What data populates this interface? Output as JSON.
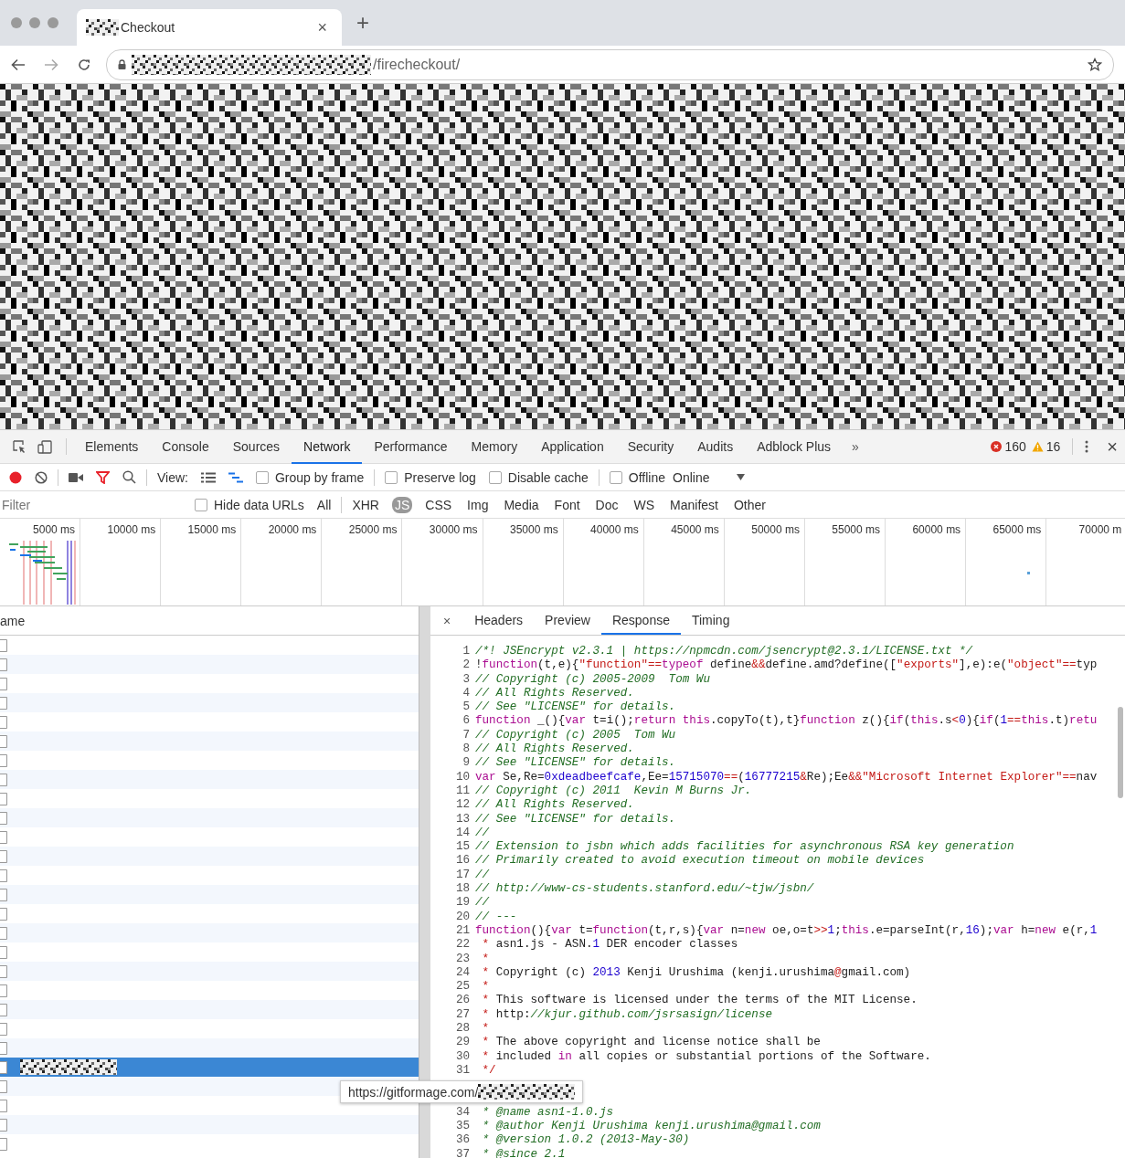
{
  "browser": {
    "tab": {
      "title": "Checkout",
      "close": "×"
    },
    "new_tab": "+",
    "address": {
      "path": "/firecheckout/"
    }
  },
  "devtools": {
    "panels": [
      {
        "label": "Elements",
        "selected": false
      },
      {
        "label": "Console",
        "selected": false
      },
      {
        "label": "Sources",
        "selected": false
      },
      {
        "label": "Network",
        "selected": true
      },
      {
        "label": "Performance",
        "selected": false
      },
      {
        "label": "Memory",
        "selected": false
      },
      {
        "label": "Application",
        "selected": false
      },
      {
        "label": "Security",
        "selected": false
      },
      {
        "label": "Audits",
        "selected": false
      },
      {
        "label": "Adblock Plus",
        "selected": false
      }
    ],
    "more": "»",
    "errors": "160",
    "warnings": "16",
    "close": "×",
    "toolbar": {
      "recording": true,
      "view_label": "View:",
      "throttle": "Online",
      "options": [
        {
          "label": "Group by frame",
          "checked": false
        },
        {
          "label": "Preserve log",
          "checked": false
        },
        {
          "label": "Disable cache",
          "checked": false
        },
        {
          "label": "Offline",
          "checked": false
        }
      ]
    },
    "filter": {
      "placeholder": "Filter",
      "hide_data_urls": {
        "label": "Hide data URLs",
        "checked": false
      },
      "types": [
        {
          "label": "All",
          "selected": false
        },
        {
          "label": "XHR",
          "selected": false
        },
        {
          "label": "JS",
          "selected": true
        },
        {
          "label": "CSS",
          "selected": false
        },
        {
          "label": "Img",
          "selected": false
        },
        {
          "label": "Media",
          "selected": false
        },
        {
          "label": "Font",
          "selected": false
        },
        {
          "label": "Doc",
          "selected": false
        },
        {
          "label": "WS",
          "selected": false
        },
        {
          "label": "Manifest",
          "selected": false
        },
        {
          "label": "Other",
          "selected": false
        }
      ]
    },
    "timeline": {
      "ticks": [
        "5000 ms",
        "10000 ms",
        "15000 ms",
        "20000 ms",
        "25000 ms",
        "30000 ms",
        "35000 ms",
        "40000 ms",
        "45000 ms",
        "50000 ms",
        "55000 ms",
        "60000 ms",
        "65000 ms",
        "70000 m"
      ]
    },
    "requests": {
      "header": "ame",
      "rows": [
        {
          "selected": false
        },
        {
          "selected": false
        },
        {
          "selected": false
        },
        {
          "selected": false
        },
        {
          "selected": false
        },
        {
          "selected": false
        },
        {
          "selected": false
        },
        {
          "selected": false
        },
        {
          "selected": false
        },
        {
          "selected": false
        },
        {
          "selected": false
        },
        {
          "selected": false
        },
        {
          "selected": false
        },
        {
          "selected": false
        },
        {
          "selected": false
        },
        {
          "selected": false
        },
        {
          "selected": false
        },
        {
          "selected": false
        },
        {
          "selected": false
        },
        {
          "selected": false
        },
        {
          "selected": false
        },
        {
          "selected": false
        },
        {
          "selected": true
        },
        {
          "selected": false
        },
        {
          "selected": false
        },
        {
          "selected": false
        },
        {
          "selected": false
        }
      ]
    },
    "detail": {
      "close": "×",
      "tabs": [
        {
          "label": "Headers",
          "selected": false
        },
        {
          "label": "Preview",
          "selected": false
        },
        {
          "label": "Response",
          "selected": true
        },
        {
          "label": "Timing",
          "selected": false
        }
      ],
      "lines": [
        {
          "kind": "code",
          "number": "1",
          "tokens": [
            {
              "kind": "c",
              "text": "/*! JSEncrypt v2.3.1 | https://npmcdn.com/jsencrypt@2.3.1/LICENSE.txt */"
            }
          ]
        },
        {
          "kind": "code",
          "number": "2",
          "tokens": [
            {
              "kind": "p",
              "text": "!"
            },
            {
              "kind": "k",
              "text": "function"
            },
            {
              "kind": "p",
              "text": "(t,e){"
            },
            {
              "kind": "s",
              "text": "\"function\""
            },
            {
              "kind": "o",
              "text": "=="
            },
            {
              "kind": "k",
              "text": "typeof"
            },
            {
              "kind": "p",
              "text": " define"
            },
            {
              "kind": "o",
              "text": "&&"
            },
            {
              "kind": "p",
              "text": "define.amd?define(["
            },
            {
              "kind": "s",
              "text": "\"exports\""
            },
            {
              "kind": "p",
              "text": "],e):e("
            },
            {
              "kind": "s",
              "text": "\"object\""
            },
            {
              "kind": "o",
              "text": "=="
            },
            {
              "kind": "p",
              "text": "typ"
            }
          ]
        },
        {
          "kind": "code",
          "number": "3",
          "tokens": [
            {
              "kind": "c",
              "text": "// Copyright (c) 2005-2009  Tom Wu"
            }
          ]
        },
        {
          "kind": "code",
          "number": "4",
          "tokens": [
            {
              "kind": "c",
              "text": "// All Rights Reserved."
            }
          ]
        },
        {
          "kind": "code",
          "number": "5",
          "tokens": [
            {
              "kind": "c",
              "text": "// See \"LICENSE\" for details."
            }
          ]
        },
        {
          "kind": "code",
          "number": "6",
          "tokens": [
            {
              "kind": "k",
              "text": "function"
            },
            {
              "kind": "p",
              "text": " _(){"
            },
            {
              "kind": "k",
              "text": "var"
            },
            {
              "kind": "p",
              "text": " t=i();"
            },
            {
              "kind": "k",
              "text": "return "
            },
            {
              "kind": "k",
              "text": "this"
            },
            {
              "kind": "p",
              "text": ".copyTo(t),t}"
            },
            {
              "kind": "k",
              "text": "function"
            },
            {
              "kind": "p",
              "text": " z(){"
            },
            {
              "kind": "k",
              "text": "if"
            },
            {
              "kind": "p",
              "text": "("
            },
            {
              "kind": "k",
              "text": "this"
            },
            {
              "kind": "p",
              "text": ".s"
            },
            {
              "kind": "o",
              "text": "<"
            },
            {
              "kind": "n",
              "text": "0"
            },
            {
              "kind": "p",
              "text": "){"
            },
            {
              "kind": "k",
              "text": "if"
            },
            {
              "kind": "p",
              "text": "("
            },
            {
              "kind": "n",
              "text": "1"
            },
            {
              "kind": "o",
              "text": "=="
            },
            {
              "kind": "k",
              "text": "this"
            },
            {
              "kind": "p",
              "text": ".t)"
            },
            {
              "kind": "k",
              "text": "retu"
            }
          ]
        },
        {
          "kind": "code",
          "number": "7",
          "tokens": [
            {
              "kind": "c",
              "text": "// Copyright (c) 2005  Tom Wu"
            }
          ]
        },
        {
          "kind": "code",
          "number": "8",
          "tokens": [
            {
              "kind": "c",
              "text": "// All Rights Reserved."
            }
          ]
        },
        {
          "kind": "code",
          "number": "9",
          "tokens": [
            {
              "kind": "c",
              "text": "// See \"LICENSE\" for details."
            }
          ]
        },
        {
          "kind": "code",
          "number": "10",
          "tokens": [
            {
              "kind": "k",
              "text": "var"
            },
            {
              "kind": "p",
              "text": " Se,Re="
            },
            {
              "kind": "n",
              "text": "0xdeadbeefcafe"
            },
            {
              "kind": "p",
              "text": ",Ee="
            },
            {
              "kind": "n",
              "text": "15715070"
            },
            {
              "kind": "o",
              "text": "=="
            },
            {
              "kind": "p",
              "text": "("
            },
            {
              "kind": "n",
              "text": "16777215"
            },
            {
              "kind": "o",
              "text": "&"
            },
            {
              "kind": "p",
              "text": "Re);Ee"
            },
            {
              "kind": "o",
              "text": "&&"
            },
            {
              "kind": "s",
              "text": "\"Microsoft Internet Explorer\""
            },
            {
              "kind": "o",
              "text": "=="
            },
            {
              "kind": "p",
              "text": "nav"
            }
          ]
        },
        {
          "kind": "code",
          "number": "11",
          "tokens": [
            {
              "kind": "c",
              "text": "// Copyright (c) 2011  Kevin M Burns Jr."
            }
          ]
        },
        {
          "kind": "code",
          "number": "12",
          "tokens": [
            {
              "kind": "c",
              "text": "// All Rights Reserved."
            }
          ]
        },
        {
          "kind": "code",
          "number": "13",
          "tokens": [
            {
              "kind": "c",
              "text": "// See \"LICENSE\" for details."
            }
          ]
        },
        {
          "kind": "code",
          "number": "14",
          "tokens": [
            {
              "kind": "c",
              "text": "//"
            }
          ]
        },
        {
          "kind": "code",
          "number": "15",
          "tokens": [
            {
              "kind": "c",
              "text": "// Extension to jsbn which adds facilities for asynchronous RSA key generation"
            }
          ]
        },
        {
          "kind": "code",
          "number": "16",
          "tokens": [
            {
              "kind": "c",
              "text": "// Primarily created to avoid execution timeout on mobile devices"
            }
          ]
        },
        {
          "kind": "code",
          "number": "17",
          "tokens": [
            {
              "kind": "c",
              "text": "//"
            }
          ]
        },
        {
          "kind": "code",
          "number": "18",
          "tokens": [
            {
              "kind": "c",
              "text": "// http://www-cs-students.stanford.edu/~tjw/jsbn/"
            }
          ]
        },
        {
          "kind": "code",
          "number": "19",
          "tokens": [
            {
              "kind": "c",
              "text": "//"
            }
          ]
        },
        {
          "kind": "code",
          "number": "20",
          "tokens": [
            {
              "kind": "c",
              "text": "// ---"
            }
          ]
        },
        {
          "kind": "code",
          "number": "21",
          "tokens": [
            {
              "kind": "k",
              "text": "function"
            },
            {
              "kind": "p",
              "text": "(){"
            },
            {
              "kind": "k",
              "text": "var"
            },
            {
              "kind": "p",
              "text": " t="
            },
            {
              "kind": "k",
              "text": "function"
            },
            {
              "kind": "p",
              "text": "(t,r,s){"
            },
            {
              "kind": "k",
              "text": "var"
            },
            {
              "kind": "p",
              "text": " n="
            },
            {
              "kind": "k",
              "text": "new"
            },
            {
              "kind": "p",
              "text": " oe,o=t"
            },
            {
              "kind": "o",
              "text": ">>"
            },
            {
              "kind": "n",
              "text": "1"
            },
            {
              "kind": "p",
              "text": ";"
            },
            {
              "kind": "k",
              "text": "this"
            },
            {
              "kind": "p",
              "text": ".e=parseInt(r,"
            },
            {
              "kind": "n",
              "text": "16"
            },
            {
              "kind": "p",
              "text": ");"
            },
            {
              "kind": "k",
              "text": "var"
            },
            {
              "kind": "p",
              "text": " h="
            },
            {
              "kind": "k",
              "text": "new"
            },
            {
              "kind": "p",
              "text": " e(r,"
            },
            {
              "kind": "n",
              "text": "1"
            }
          ]
        },
        {
          "kind": "code",
          "number": "22",
          "tokens": [
            {
              "kind": "o",
              "text": " * "
            },
            {
              "kind": "p",
              "text": "asn1.js - ASN."
            },
            {
              "kind": "n",
              "text": "1"
            },
            {
              "kind": "p",
              "text": " DER encoder classes"
            }
          ]
        },
        {
          "kind": "code",
          "number": "23",
          "tokens": [
            {
              "kind": "o",
              "text": " *"
            }
          ]
        },
        {
          "kind": "code",
          "number": "24",
          "tokens": [
            {
              "kind": "o",
              "text": " * "
            },
            {
              "kind": "p",
              "text": "Copyright (c) "
            },
            {
              "kind": "n",
              "text": "2013"
            },
            {
              "kind": "p",
              "text": " Kenji Urushima (kenji.urushima"
            },
            {
              "kind": "o",
              "text": "@"
            },
            {
              "kind": "p",
              "text": "gmail.com)"
            }
          ]
        },
        {
          "kind": "code",
          "number": "25",
          "tokens": [
            {
              "kind": "o",
              "text": " *"
            }
          ]
        },
        {
          "kind": "code",
          "number": "26",
          "tokens": [
            {
              "kind": "o",
              "text": " * "
            },
            {
              "kind": "p",
              "text": "This software is licensed under the terms of the MIT License."
            }
          ]
        },
        {
          "kind": "code",
          "number": "27",
          "tokens": [
            {
              "kind": "o",
              "text": " * "
            },
            {
              "kind": "p",
              "text": "http:"
            },
            {
              "kind": "c",
              "text": "//kjur.github.com/jsrsasign/license"
            }
          ]
        },
        {
          "kind": "code",
          "number": "28",
          "tokens": [
            {
              "kind": "o",
              "text": " *"
            }
          ]
        },
        {
          "kind": "code",
          "number": "29",
          "tokens": [
            {
              "kind": "o",
              "text": " * "
            },
            {
              "kind": "p",
              "text": "The above copyright and license notice shall be"
            }
          ]
        },
        {
          "kind": "code",
          "number": "30",
          "tokens": [
            {
              "kind": "o",
              "text": " * "
            },
            {
              "kind": "p",
              "text": "included "
            },
            {
              "kind": "k",
              "text": "in"
            },
            {
              "kind": "p",
              "text": " all copies or substantial portions of the Software."
            }
          ]
        },
        {
          "kind": "code",
          "number": "31",
          "tokens": [
            {
              "kind": "o",
              "text": " */"
            }
          ]
        },
        {
          "kind": "covered"
        },
        {
          "kind": "code",
          "number": "34",
          "tokens": [
            {
              "kind": "c",
              "text": " * @name asn1-1.0.js"
            }
          ]
        },
        {
          "kind": "code",
          "number": "35",
          "tokens": [
            {
              "kind": "c",
              "text": " * @author Kenji Urushima kenji.urushima@gmail.com"
            }
          ]
        },
        {
          "kind": "code",
          "number": "36",
          "tokens": [
            {
              "kind": "c",
              "text": " * @version 1.0.2 (2013-May-30)"
            }
          ]
        },
        {
          "kind": "code",
          "number": "37",
          "tokens": [
            {
              "kind": "c",
              "text": " * @since 2.1"
            }
          ]
        }
      ]
    },
    "tooltip": {
      "text": "https://gitformage.com/"
    }
  }
}
